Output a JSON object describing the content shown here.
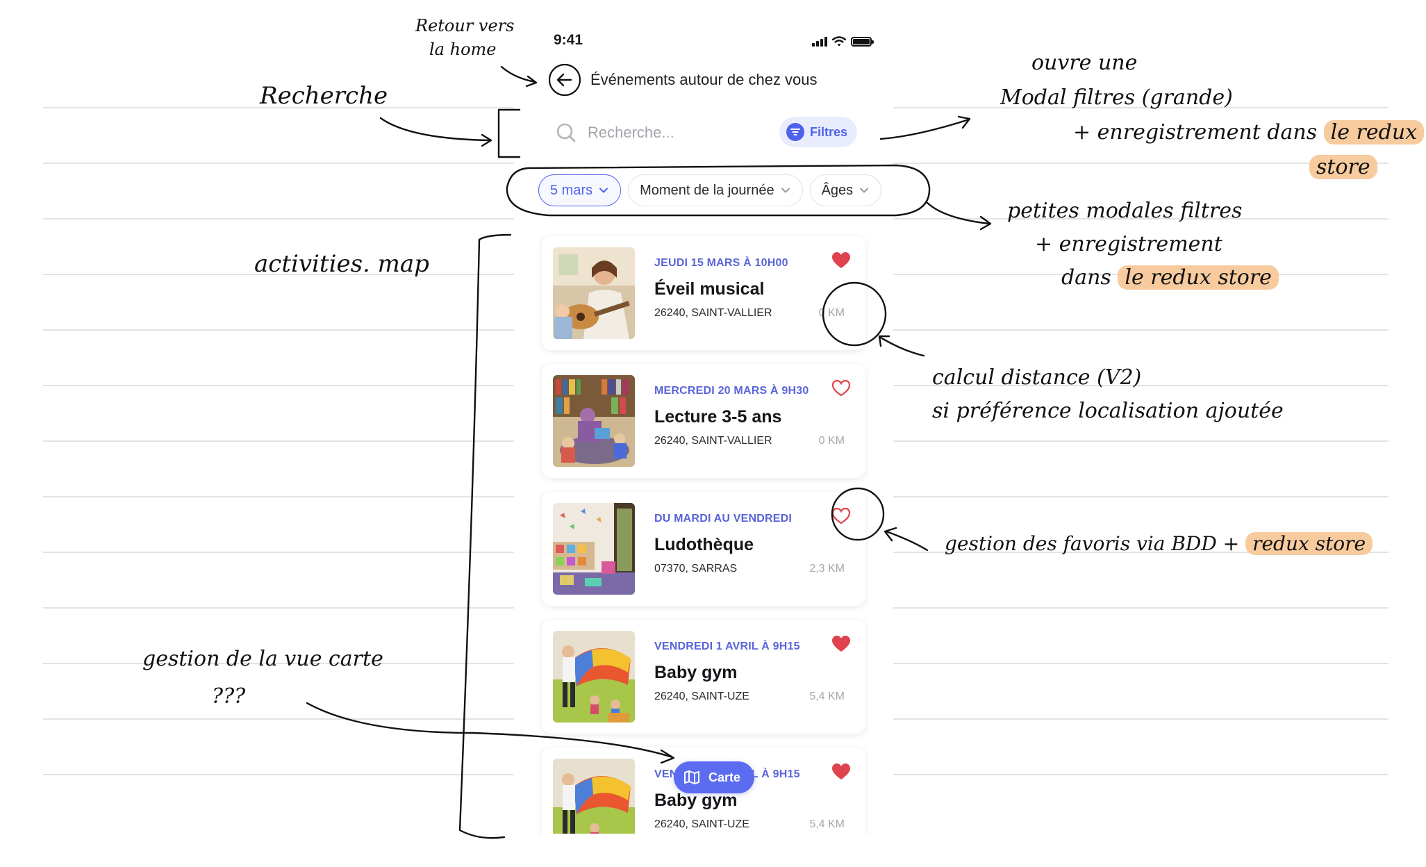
{
  "status_bar": {
    "time": "9:41"
  },
  "header": {
    "title": "Événements autour de chez vous"
  },
  "search": {
    "placeholder": "Recherche...",
    "filters_label": "Filtres"
  },
  "chips": [
    {
      "label": "5 mars",
      "active": true
    },
    {
      "label": "Moment de la journée",
      "active": false
    },
    {
      "label": "Âges",
      "active": false
    }
  ],
  "events": [
    {
      "date": "JEUDI 15 MARS À 10H00",
      "title": "Éveil musical",
      "location": "26240, SAINT-VALLIER",
      "distance": "0 KM",
      "favorite": true
    },
    {
      "date": "MERCREDI 20 MARS À 9H30",
      "title": "Lecture 3-5 ans",
      "location": "26240, SAINT-VALLIER",
      "distance": "0 KM",
      "favorite": false
    },
    {
      "date": "DU MARDI AU VENDREDI",
      "title": "Ludothèque",
      "location": "07370, SARRAS",
      "distance": "2,3 KM",
      "favorite": false
    },
    {
      "date": "VENDREDI 1 AVRIL À 9H15",
      "title": "Baby gym",
      "location": "26240, SAINT-UZE",
      "distance": "5,4 KM",
      "favorite": true
    },
    {
      "date": "VENDREDI 1 AVRIL À 9H15",
      "title": "Baby gym",
      "location": "26240, SAINT-UZE",
      "distance": "5,4 KM",
      "favorite": true
    }
  ],
  "map_button": {
    "label": "Carte"
  },
  "annotations": {
    "retour_line1": "Retour vers",
    "retour_line2": "la home",
    "recherche": "Recherche",
    "filtres_line1": "ouvre une",
    "filtres_line2": "Modal filtres (grande)",
    "filtres_line3": "+ enregistrement dans",
    "filtres_hl1": "le redux",
    "filtres_hl2": "store",
    "chips_line1": "petites modales filtres",
    "chips_line2": "+ enregistrement",
    "chips_line3": "dans",
    "chips_hl": "le redux store",
    "activities": "activities. map",
    "distance_line1": "calcul distance (V2)",
    "distance_line2": "si préférence localisation ajoutée",
    "favoris_text": "gestion des favoris via BDD +",
    "favoris_hl": "redux store",
    "carte_line1": "gestion de la vue carte",
    "carte_line2": "???"
  },
  "colors": {
    "accent": "#4e63ea",
    "heart": "#e0434d",
    "highlight": "#f7cb9e"
  }
}
